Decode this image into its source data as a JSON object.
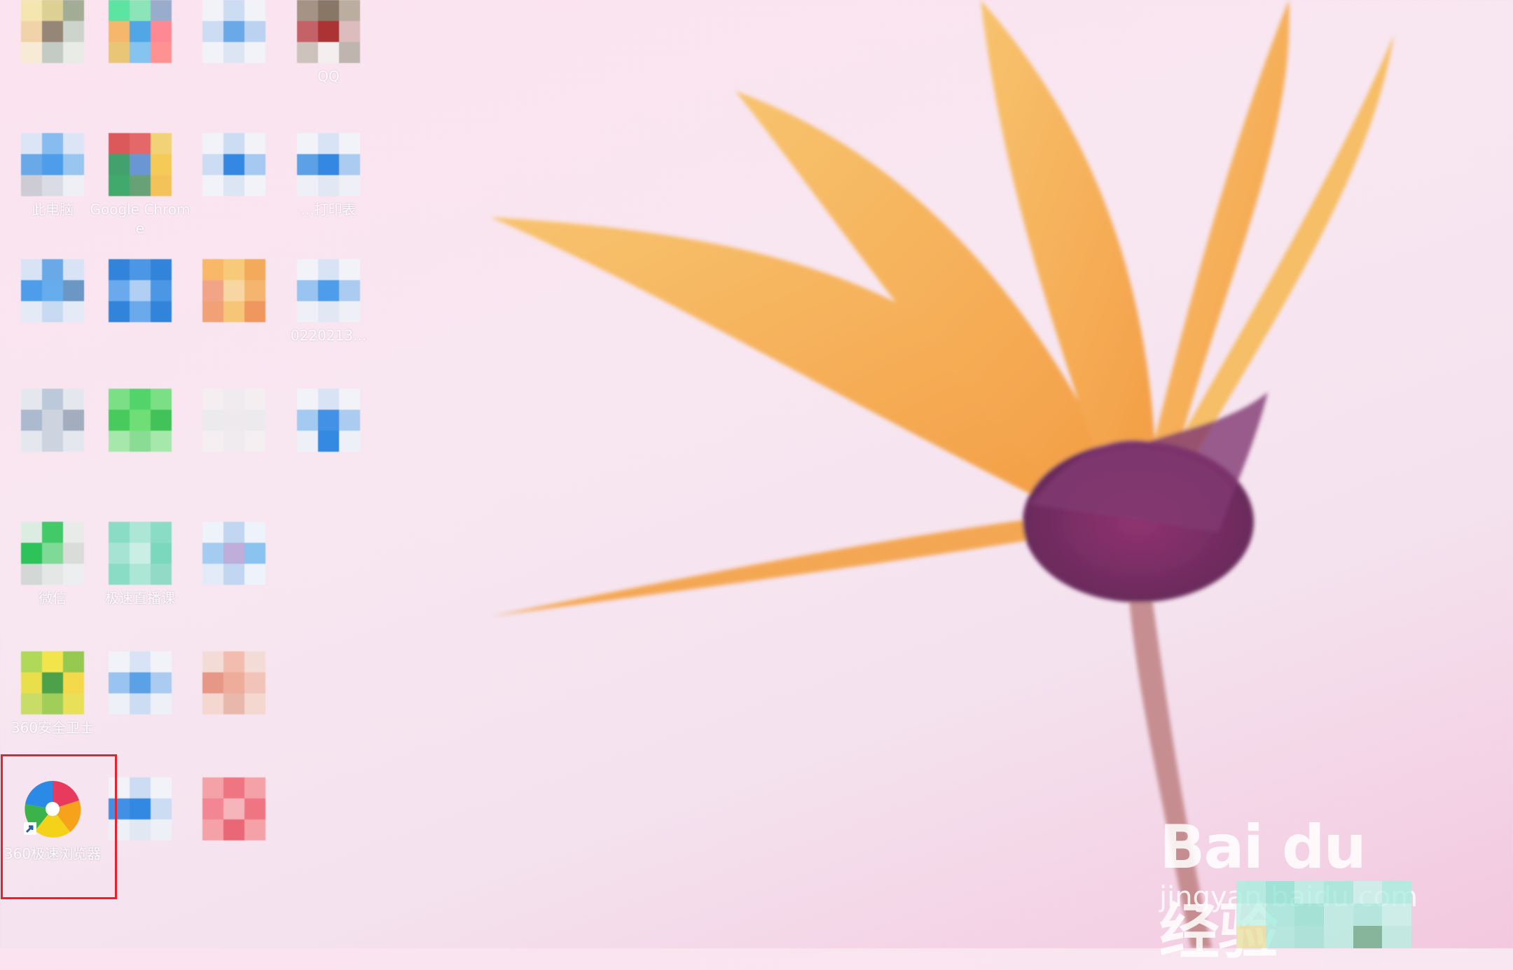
{
  "desktop": {
    "icons": [
      {
        "label": "",
        "colors": [
          "#f4e7a8",
          "#d9cf8a",
          "#9aa88d",
          "#f0d2a2",
          "#8c7c6c",
          "#c7d3c8",
          "#f7ecd3",
          "#bfc9c0",
          "#e6ece6"
        ]
      },
      {
        "label": "",
        "colors": [
          "#4de39a",
          "#7fe6b4",
          "#8fa7c9",
          "#f4b35e",
          "#3fa1e6",
          "#ff7f8a",
          "#e8c36b",
          "#79c0f2",
          "#ff8a8a"
        ]
      },
      {
        "label": "",
        "colors": [
          "#f2f5fa",
          "#c8dcf4",
          "#f2f5fa",
          "#c8dcf4",
          "#5aa3e8",
          "#b6d1f2",
          "#f2f5fa",
          "#d9e6f5",
          "#f2f5fa"
        ]
      },
      {
        "label": "QQ",
        "colors": [
          "#9c8c7a",
          "#7c6b58",
          "#b5a897",
          "#c0555a",
          "#a32020",
          "#d9b8b8",
          "#c9c0b7",
          "#f5f0ef",
          "#b9b0a8"
        ]
      },
      {
        "label": "此电脑",
        "colors": [
          "#d8e6f6",
          "#7ab8ef",
          "#d8e6f6",
          "#5aa3e8",
          "#3c96ea",
          "#8ec3f1",
          "#c9c9d2",
          "#d7dce4",
          "#eef2f7"
        ]
      },
      {
        "label": "Google Chrome",
        "colors": [
          "#d84a4a",
          "#e25b5b",
          "#f2d16b",
          "#2f9a5e",
          "#5b8fd0",
          "#f6c846",
          "#2fa35f",
          "#5a9a6a",
          "#f3c04a"
        ]
      },
      {
        "label": "",
        "colors": [
          "#f2f5fa",
          "#c8dcf4",
          "#f2f5fa",
          "#c8dcf4",
          "#1f7fe0",
          "#9cc7f2",
          "#f2f5fa",
          "#d9e6f5",
          "#f2f5fa"
        ]
      },
      {
        "label": "...打印表",
        "colors": [
          "#f2f5fa",
          "#d5e4f6",
          "#f2f5fa",
          "#4b9ae6",
          "#1f7fe0",
          "#a3c9f1",
          "#eef2f8",
          "#dfe8f4",
          "#eef2f8"
        ]
      },
      {
        "label": "",
        "colors": [
          "#d5e4f6",
          "#5aa3e8",
          "#d5e4f6",
          "#3c96ea",
          "#56a7ec",
          "#5c8fc0",
          "#e2ecf7",
          "#c3d9f2",
          "#e2ecf7"
        ]
      },
      {
        "label": "",
        "colors": [
          "#1d7ad8",
          "#3a8fe4",
          "#1d7ad8",
          "#5aa3ec",
          "#a9cdf3",
          "#3a8fe4",
          "#1d7ad8",
          "#5aa3ec",
          "#1d7ad8"
        ]
      },
      {
        "label": "",
        "colors": [
          "#f8b45a",
          "#f7c86e",
          "#f3a44a",
          "#f29f7b",
          "#f8d59a",
          "#f4b060",
          "#f29a6a",
          "#f7c26a",
          "#ef8f4f"
        ]
      },
      {
        "label": "0220213...",
        "colors": [
          "#f2f5fa",
          "#d5e4f6",
          "#f2f5fa",
          "#8fc0f0",
          "#3c96ea",
          "#a3c9f1",
          "#eef2f8",
          "#dfe8f4",
          "#eef2f8"
        ]
      },
      {
        "label": "",
        "colors": [
          "#e3e8ef",
          "#b6c7d9",
          "#e3e8ef",
          "#a3b6cb",
          "#c9d3de",
          "#9aa7b8",
          "#e3e8ef",
          "#c9d3de",
          "#e3e8ef"
        ]
      },
      {
        "label": "",
        "colors": [
          "#6ee07a",
          "#42d35c",
          "#6ee07a",
          "#36c84e",
          "#61de6a",
          "#2fc04a",
          "#9ee8a4",
          "#7fdc8a",
          "#9ee8a4"
        ]
      },
      {
        "label": "",
        "colors": [
          "#f4f0f2",
          "#f0ecee",
          "#f4f0f2",
          "#ecebee",
          "#eeeaec",
          "#ecebee",
          "#f4f0f2",
          "#f0ecee",
          "#f4f0f2"
        ]
      },
      {
        "label": "",
        "colors": [
          "#f2f5fa",
          "#d5e4f6",
          "#f2f5fa",
          "#9cc7f2",
          "#2f88e6",
          "#a3c9f1",
          "#eef2f8",
          "#1f7fe0",
          "#eef2f8"
        ]
      },
      {
        "label": "微信",
        "colors": [
          "#d8eee0",
          "#2fc65a",
          "#e8ece9",
          "#19c04a",
          "#73d98f",
          "#d7dbd8",
          "#cfd6d2",
          "#e4e8e5",
          "#eceff0"
        ]
      },
      {
        "label": "极速直播课",
        "colors": [
          "#7fdcc0",
          "#a4e6d2",
          "#7fdcc0",
          "#9ee3cf",
          "#c6efe3",
          "#6fd7b8",
          "#7fdcc0",
          "#a4e6d2",
          "#88d8c2"
        ]
      },
      {
        "label": "",
        "colors": [
          "#eef4fb",
          "#bcd6f2",
          "#eef4fb",
          "#9ccaf2",
          "#b9a7d8",
          "#7fbff0",
          "#e0ecf8",
          "#bcd6f2",
          "#eef4fb"
        ]
      },
      {
        "label": "360安全卫士",
        "colors": [
          "#a9d84a",
          "#f2e43a",
          "#8cc63f",
          "#e8df3a",
          "#3a9a3a",
          "#f4d83a",
          "#c4dc5a",
          "#98cc48",
          "#e8e04a"
        ]
      },
      {
        "label": "",
        "colors": [
          "#f2f5fa",
          "#d5e4f6",
          "#f2f5fa",
          "#8fc0f0",
          "#4b9ae6",
          "#a3c9f1",
          "#eef2f8",
          "#c8ddf4",
          "#eef2f8"
        ]
      },
      {
        "label": "",
        "colors": [
          "#f4dcd4",
          "#f2b8a8",
          "#f4dcd4",
          "#e58f7a",
          "#eea892",
          "#f2c0b2",
          "#f4d6cc",
          "#e8b4a6",
          "#f4d6cc"
        ]
      },
      {
        "label": "360极速浏览器",
        "colors": []
      },
      {
        "label": "",
        "colors": [
          "#f2f5fa",
          "#c8dcf4",
          "#f2f5fa",
          "#2f88e6",
          "#1f7fe0",
          "#c8dcf4",
          "#eef2f8",
          "#dfe8f4",
          "#eef2f8"
        ]
      },
      {
        "label": "",
        "colors": [
          "#f49aa0",
          "#f06a78",
          "#f49aa0",
          "#f27c88",
          "#f6b0b6",
          "#f06a78",
          "#f49aa0",
          "#e85a6a",
          "#f49aa0"
        ]
      }
    ]
  },
  "watermark": {
    "logo_text": "Bai du 经验",
    "url_text": "jingyan.baidu.com"
  },
  "colors": {
    "selection": "#e8222a",
    "petal": "#f7b24a",
    "center": "#7a2a5a"
  }
}
